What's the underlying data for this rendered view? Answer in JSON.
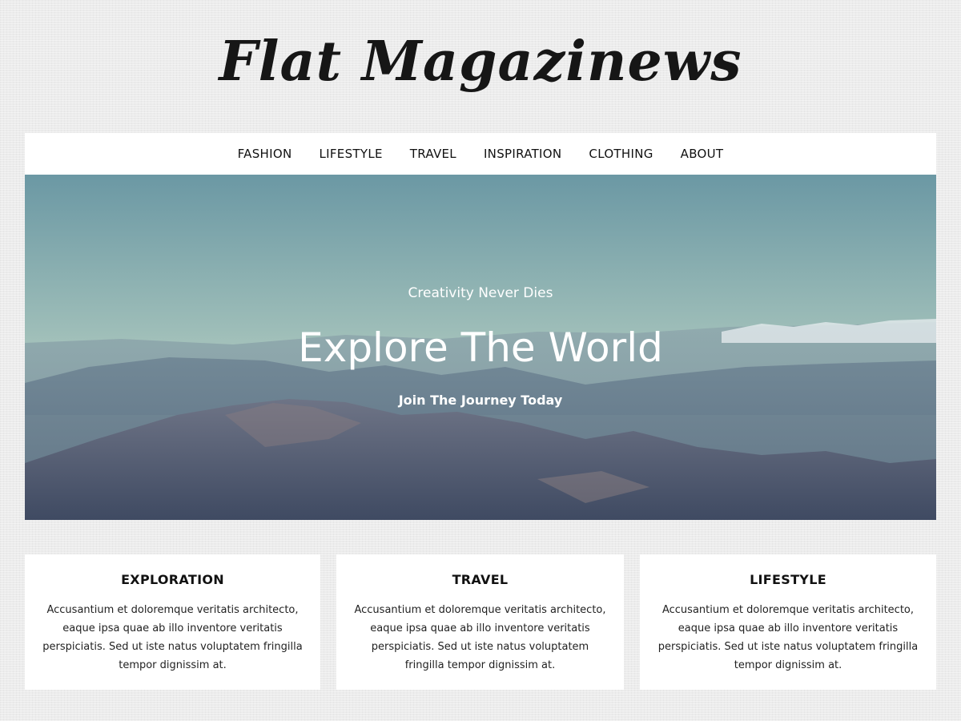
{
  "site": {
    "logo_text": "Flat Magazinews"
  },
  "nav": {
    "items": [
      {
        "label": "FASHION"
      },
      {
        "label": "LIFESTYLE"
      },
      {
        "label": "TRAVEL"
      },
      {
        "label": "INSPIRATION"
      },
      {
        "label": "CLOTHING"
      },
      {
        "label": "ABOUT"
      }
    ]
  },
  "hero": {
    "subtitle": "Creativity Never Dies",
    "title": "Explore The World",
    "cta": "Join The Journey Today"
  },
  "features": [
    {
      "title": "EXPLORATION",
      "text": "Accusantium et doloremque veritatis architecto, eaque ipsa quae ab illo inventore veritatis perspiciatis. Sed ut iste natus voluptatem fringilla tempor dignissim at."
    },
    {
      "title": "TRAVEL",
      "text": "Accusantium et doloremque veritatis architecto, eaque ipsa quae ab illo inventore veritatis perspiciatis. Sed ut iste natus voluptatem fringilla tempor dignissim at."
    },
    {
      "title": "LIFESTYLE",
      "text": "Accusantium et doloremque veritatis architecto, eaque ipsa quae ab illo inventore veritatis perspiciatis. Sed ut iste natus voluptatem fringilla tempor dignissim at."
    }
  ],
  "colors": {
    "page_background": "#ececec",
    "panel_background": "#ffffff",
    "text": "#111111",
    "hero_text": "#ffffff"
  }
}
